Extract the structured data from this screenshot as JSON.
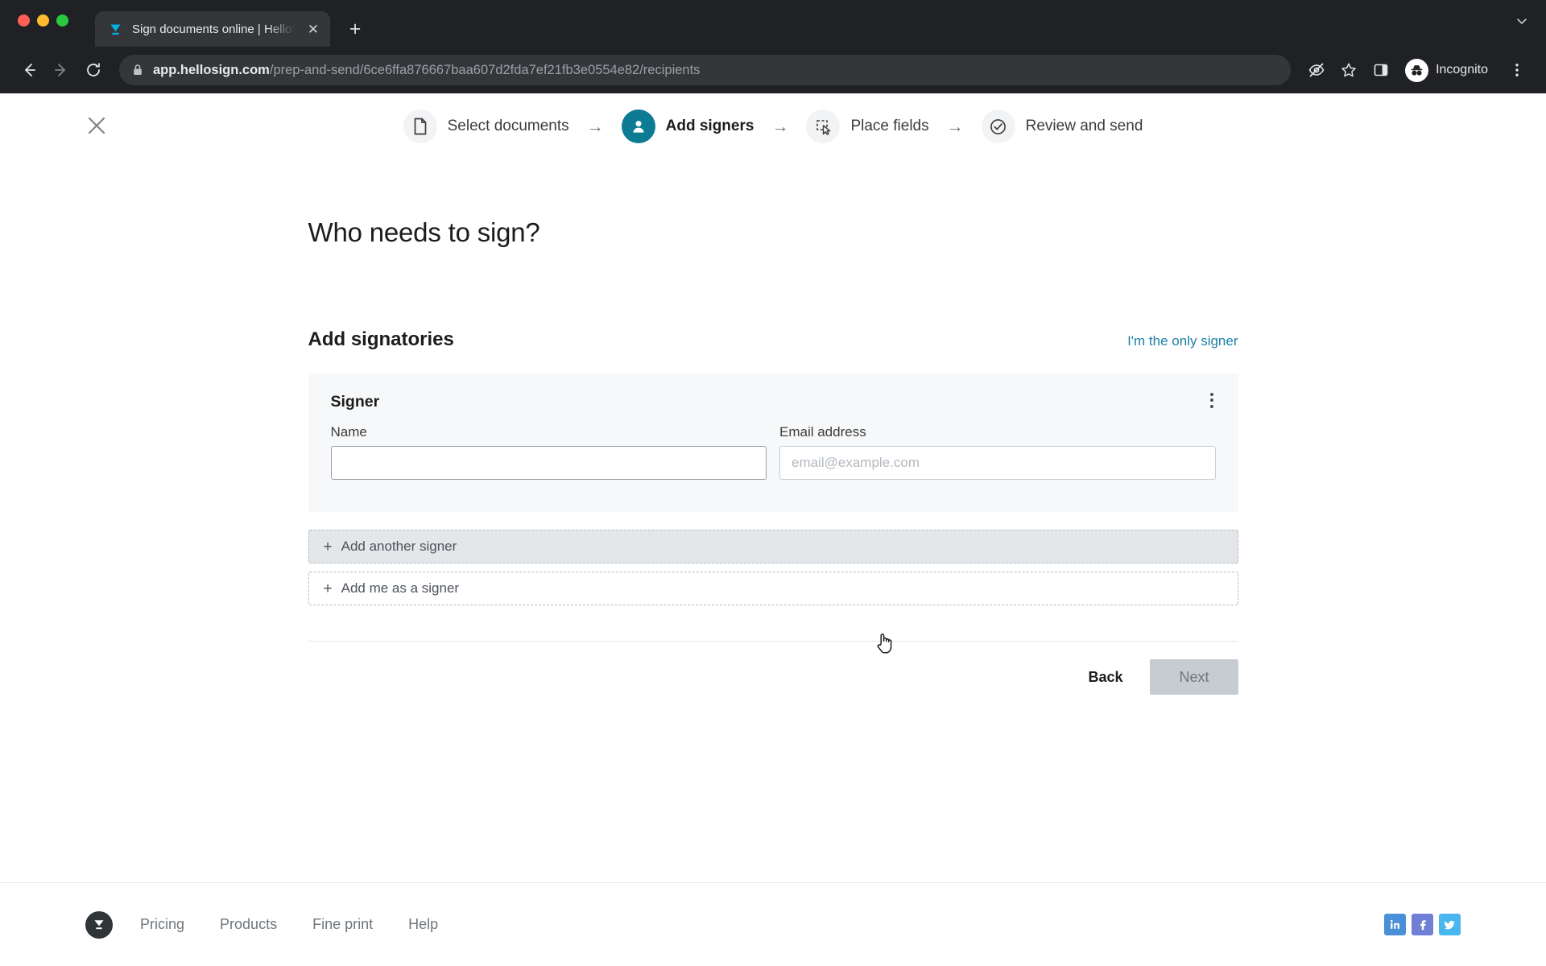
{
  "browser": {
    "tab": {
      "title": "Sign documents online | HelloS",
      "favicon": "hellosign-icon",
      "close_label": "✕"
    },
    "new_tab_label": "+",
    "toolbar": {
      "back_icon": "arrow-left-icon",
      "forward_icon": "arrow-right-icon",
      "reload_icon": "reload-icon",
      "lock_icon": "lock-icon",
      "url_domain": "app.hellosign.com",
      "url_path": "/prep-and-send/6ce6ffa876667baa607d2fda7ef21fb3e0554e82/recipients",
      "eye_off_icon": "eye-off-icon",
      "bookmark_icon": "star-icon",
      "side_panel_icon": "side-panel-icon",
      "incognito_label": "Incognito",
      "incognito_icon": "incognito-avatar-icon",
      "menu_icon": "three-dot-menu-icon"
    },
    "tabstrip_expand_icon": "chevron-down-icon"
  },
  "page": {
    "close_icon": "close-icon",
    "stepper": [
      {
        "label": "Select documents",
        "icon": "document-icon",
        "active": false
      },
      {
        "label": "Add signers",
        "icon": "person-icon",
        "active": true
      },
      {
        "label": "Place fields",
        "icon": "place-fields-icon",
        "active": false
      },
      {
        "label": "Review and send",
        "icon": "check-circle-icon",
        "active": false
      }
    ],
    "stepper_arrow": "→",
    "title": "Who needs to sign?",
    "signatories": {
      "heading": "Add signatories",
      "only_signer_link": "I'm the only signer",
      "card": {
        "title": "Signer",
        "menu_icon": "kebab-menu-icon",
        "name_label": "Name",
        "name_value": "",
        "name_placeholder": "",
        "email_label": "Email address",
        "email_value": "",
        "email_placeholder": "email@example.com"
      },
      "add_another_signer": "Add another signer",
      "add_me_as_signer": "Add me as a signer",
      "plus_glyph": "+"
    },
    "nav": {
      "back_label": "Back",
      "next_label": "Next"
    },
    "footer": {
      "logo_icon": "hellosign-logo-icon",
      "links": [
        "Pricing",
        "Products",
        "Fine print",
        "Help"
      ],
      "social": [
        {
          "name": "linkedin",
          "glyph": "in",
          "color": "#4a90d9"
        },
        {
          "name": "facebook",
          "glyph": "f",
          "color": "#6f7fd4"
        },
        {
          "name": "twitter",
          "glyph": "ᵗ",
          "color": "#49b7ee"
        }
      ]
    }
  },
  "colors": {
    "accent_teal": "#0c7b93",
    "link_blue": "#1f7fa8",
    "chrome_bg": "#202124",
    "card_bg": "#f7f8f9"
  }
}
